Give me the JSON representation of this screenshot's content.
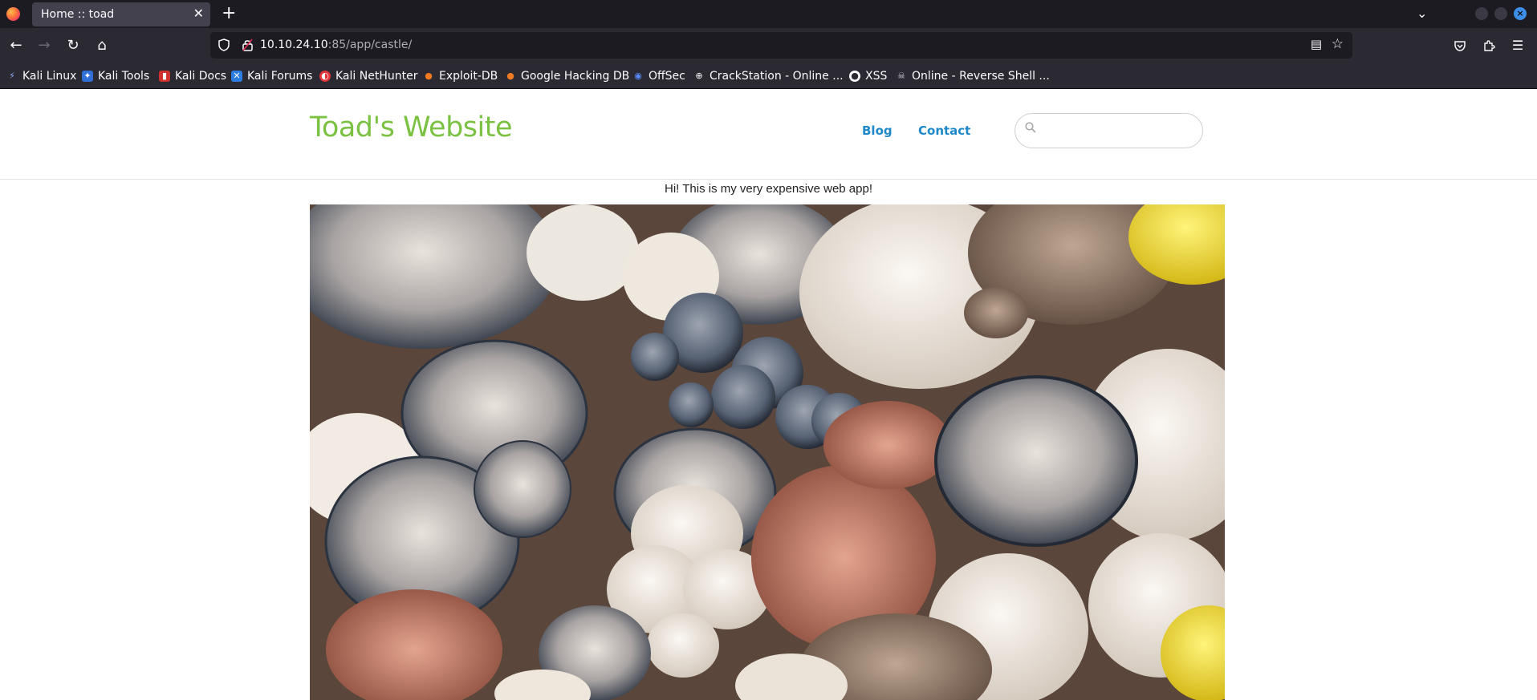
{
  "browser": {
    "tab": {
      "title": "Home :: toad",
      "close": "✕"
    },
    "new_tab": "+",
    "url": {
      "host": "10.10.24.10",
      "rest": ":85/app/castle/"
    },
    "bookmarks": [
      {
        "label": "Kali Linux",
        "icon": "kali-linux-icon",
        "color": "#367bf0"
      },
      {
        "label": "Kali Tools",
        "icon": "kali-tools-icon",
        "color": "#2f6fd6"
      },
      {
        "label": "Kali Docs",
        "icon": "kali-docs-icon",
        "color": "#d0312d"
      },
      {
        "label": "Kali Forums",
        "icon": "kali-forums-icon",
        "color": "#2d7de3"
      },
      {
        "label": "Kali NetHunter",
        "icon": "kali-nethunter-icon",
        "color": "#e0333a"
      },
      {
        "label": "Exploit-DB",
        "icon": "exploit-db-icon",
        "color": "#f07a1f"
      },
      {
        "label": "Google Hacking DB",
        "icon": "ghdb-icon",
        "color": "#f07a1f"
      },
      {
        "label": "OffSec",
        "icon": "offsec-icon",
        "color": "#3a6fd8"
      },
      {
        "label": "CrackStation - Online ...",
        "icon": "globe-icon",
        "color": "#8f8f9d"
      },
      {
        "label": "XSS",
        "icon": "github-icon",
        "color": "#ffffff"
      },
      {
        "label": "Online - Reverse Shell ...",
        "icon": "skull-icon",
        "color": "#cfcfd8"
      }
    ]
  },
  "site": {
    "title": "Toad's Website",
    "nav": {
      "blog": "Blog",
      "contact": "Contact"
    },
    "search_placeholder": "",
    "intro": "Hi! This is my very expensive web app!"
  },
  "colors": {
    "title_green": "#7bc142",
    "link_blue": "#1e88c8"
  }
}
